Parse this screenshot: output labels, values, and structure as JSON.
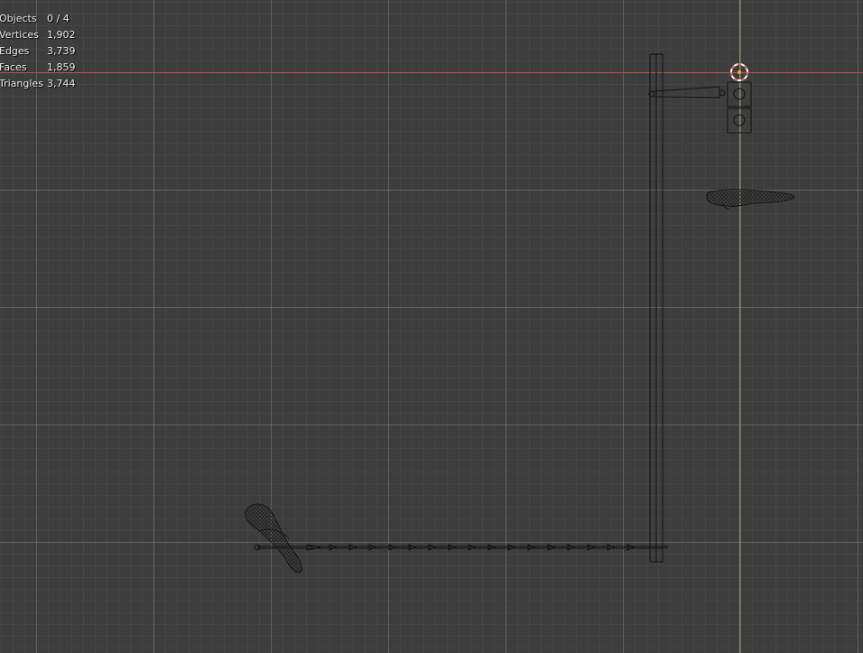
{
  "stats": {
    "rows": [
      {
        "label": "Objects",
        "value": "0 / 4"
      },
      {
        "label": "Vertices",
        "value": "1,902"
      },
      {
        "label": "Edges",
        "value": "3,739"
      },
      {
        "label": "Faces",
        "value": "1,859"
      },
      {
        "label": "Triangles",
        "value": "3,744"
      }
    ]
  },
  "colors": {
    "background": "#3d3d3d",
    "x_axis": "#d94b4b",
    "y_axis": "#7fb52e",
    "wire": "#111111",
    "cursor_red": "#e25a4a",
    "cursor_white": "#ffffff"
  },
  "icons": [
    "3d-cursor-icon"
  ]
}
